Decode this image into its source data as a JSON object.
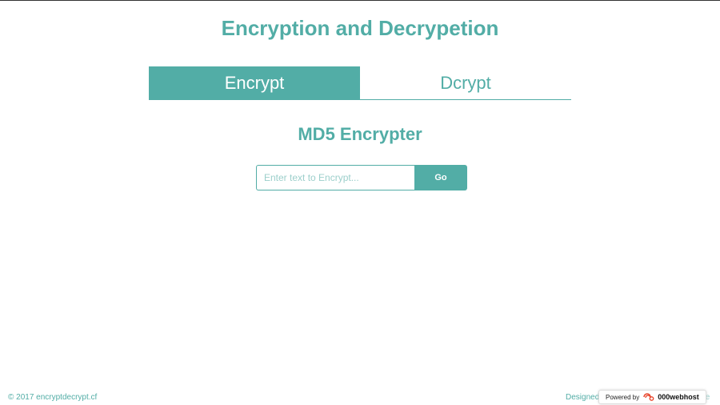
{
  "header": {
    "title": "Encryption and Decrypetion"
  },
  "tabs": [
    {
      "label": "Encrypt",
      "active": true
    },
    {
      "label": "Dcrypt",
      "active": false
    }
  ],
  "section": {
    "title": "MD5 Encrypter"
  },
  "form": {
    "input_placeholder": "Enter text to Encrypt...",
    "input_value": "",
    "go_label": "Go"
  },
  "footer": {
    "copyright": "© 2017 encryptdecrypt.cf",
    "designed_prefix": "Designed &",
    "designed_tail": "ale"
  },
  "badge": {
    "powered_by": "Powered by",
    "brand": "000webhost",
    "icon": "000webhost-logo-icon"
  },
  "colors": {
    "accent": "#52ada6",
    "background": "#ffffff"
  }
}
